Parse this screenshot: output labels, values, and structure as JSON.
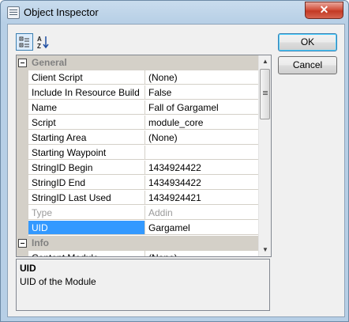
{
  "window": {
    "title": "Object Inspector",
    "close_glyph": "✕",
    "icon": "window-app-icon"
  },
  "toolbar": {
    "categorized_icon": "categorized-view-icon",
    "alphabetical_icon": "sort-az-icon",
    "alpha_top": "A",
    "alpha_bottom": "Z"
  },
  "buttons": {
    "ok": "OK",
    "cancel": "Cancel"
  },
  "grid": {
    "categories": [
      {
        "label": "General",
        "rows": [
          {
            "name": "Client Script",
            "value": "(None)"
          },
          {
            "name": "Include In Resource Build",
            "value": "False"
          },
          {
            "name": "Name",
            "value": "Fall of Gargamel"
          },
          {
            "name": "Script",
            "value": "module_core"
          },
          {
            "name": "Starting Area",
            "value": "(None)"
          },
          {
            "name": "Starting Waypoint",
            "value": ""
          },
          {
            "name": "StringID Begin",
            "value": "1434924422"
          },
          {
            "name": "StringID End",
            "value": "1434934422"
          },
          {
            "name": "StringID Last Used",
            "value": "1434924421"
          },
          {
            "name": "Type",
            "value": "Addin",
            "disabled": true
          },
          {
            "name": "UID",
            "value": "Gargamel",
            "selected": true
          }
        ]
      },
      {
        "label": "Info",
        "rows": [
          {
            "name": "Content Module",
            "value": "(None)"
          }
        ]
      }
    ],
    "scroll": {
      "up": "▲",
      "down": "▼"
    }
  },
  "description": {
    "title": "UID",
    "text": "UID of the Module"
  },
  "colors": {
    "selection": "#3399ff",
    "close_button": "#c33a25",
    "gutter": "#d4d0c8"
  }
}
